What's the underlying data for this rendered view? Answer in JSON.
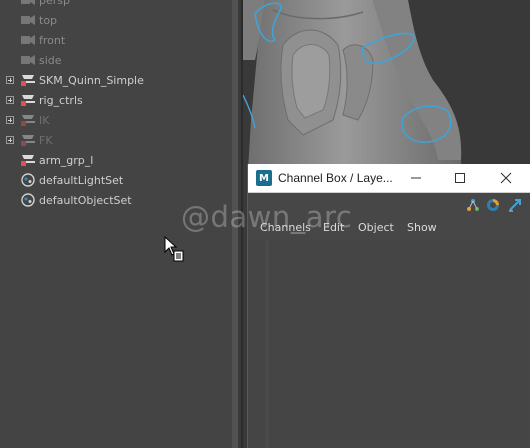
{
  "outliner": {
    "items": [
      {
        "label": "persp",
        "icon": "camera-icon",
        "state": "dimmed"
      },
      {
        "label": "top",
        "icon": "camera-icon",
        "state": "dimmed"
      },
      {
        "label": "front",
        "icon": "camera-icon",
        "state": "dimmed"
      },
      {
        "label": "side",
        "icon": "camera-icon",
        "state": "dimmed"
      },
      {
        "label": "SKM_Quinn_Simple",
        "icon": "group-transform-icon",
        "state": "normal",
        "expandable": true
      },
      {
        "label": "rig_ctrls",
        "icon": "group-transform-icon",
        "state": "normal",
        "expandable": true
      },
      {
        "label": "IK",
        "icon": "group-transform-icon",
        "state": "hidden",
        "expandable": true
      },
      {
        "label": "FK",
        "icon": "group-transform-icon",
        "state": "hidden",
        "expandable": true
      },
      {
        "label": "arm_grp_l",
        "icon": "group-transform-icon",
        "state": "normal"
      },
      {
        "label": "defaultLightSet",
        "icon": "set-icon",
        "state": "normal"
      },
      {
        "label": "defaultObjectSet",
        "icon": "set-icon",
        "state": "normal"
      }
    ]
  },
  "channel_box": {
    "title": "Channel Box / Laye...",
    "app_icon": "maya-icon",
    "menus": [
      "Channels",
      "Edit",
      "Object",
      "Show"
    ],
    "toolbar_icons": [
      "channel-box-icon",
      "layer-editor-icon",
      "attribute-editor-icon"
    ]
  },
  "viewport": {
    "model_color": "#8a8a8a",
    "control_curve_color": "#3fa3d8"
  },
  "watermark": {
    "text": "@dawn_arc"
  },
  "colors": {
    "panel_bg": "#444444",
    "window_titlebar": "#ffffff",
    "text": "#cfcfcf",
    "dimmed_text": "#8a8a8a"
  }
}
